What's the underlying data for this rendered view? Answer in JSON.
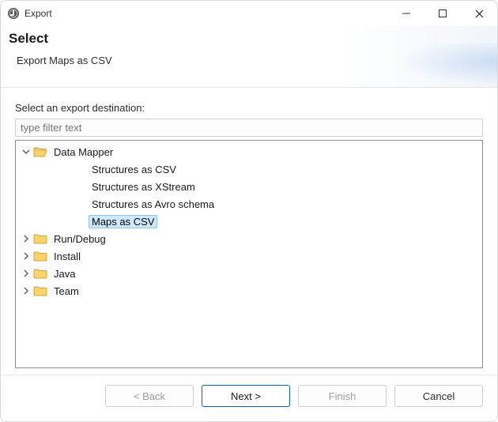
{
  "window": {
    "title": "Export"
  },
  "banner": {
    "heading": "Select",
    "subheading": "Export Maps as CSV"
  },
  "body": {
    "label": "Select an export destination:",
    "filter_placeholder": "type filter text"
  },
  "tree": {
    "nodes": [
      {
        "label": "Data Mapper",
        "level": 1,
        "icon": "folder-open",
        "expander": "down",
        "selected": false,
        "interactable": true
      },
      {
        "label": "Structures as CSV",
        "level": 2,
        "icon": "none",
        "expander": "none",
        "selected": false,
        "interactable": true
      },
      {
        "label": "Structures as XStream",
        "level": 2,
        "icon": "none",
        "expander": "none",
        "selected": false,
        "interactable": true
      },
      {
        "label": "Structures as Avro schema",
        "level": 2,
        "icon": "none",
        "expander": "none",
        "selected": false,
        "interactable": true
      },
      {
        "label": "Maps as CSV",
        "level": 2,
        "icon": "none",
        "expander": "none",
        "selected": true,
        "interactable": true
      },
      {
        "label": "Run/Debug",
        "level": 1,
        "icon": "folder",
        "expander": "right",
        "selected": false,
        "interactable": true
      },
      {
        "label": "Install",
        "level": 1,
        "icon": "folder",
        "expander": "right",
        "selected": false,
        "interactable": true
      },
      {
        "label": "Java",
        "level": 1,
        "icon": "folder",
        "expander": "right",
        "selected": false,
        "interactable": true
      },
      {
        "label": "Team",
        "level": 1,
        "icon": "folder",
        "expander": "right",
        "selected": false,
        "interactable": true
      }
    ]
  },
  "footer": {
    "back": "< Back",
    "next": "Next >",
    "finish": "Finish",
    "cancel": "Cancel"
  }
}
